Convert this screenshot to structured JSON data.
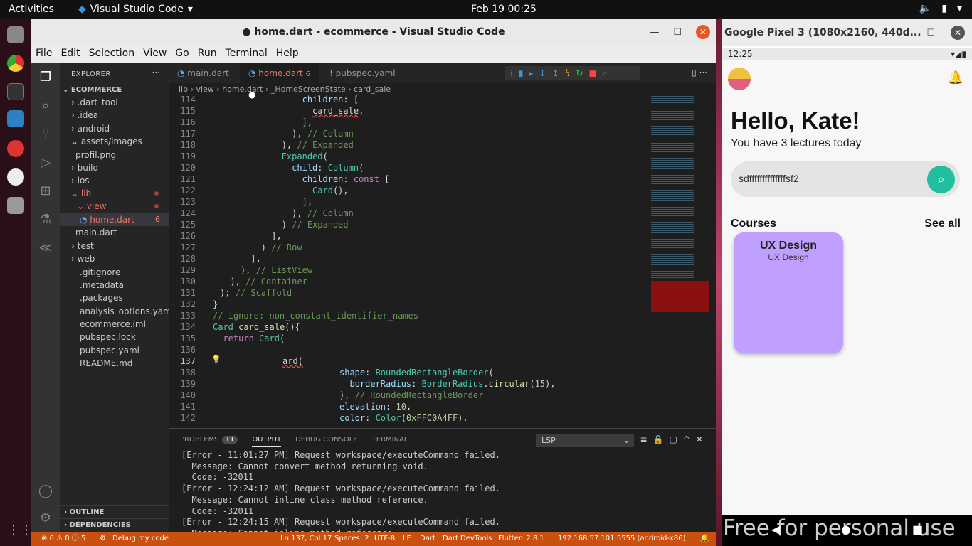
{
  "topbar": {
    "activities": "Activities",
    "app_name": "Visual Studio Code",
    "clock": "Feb 19  00:25"
  },
  "vscode": {
    "window_title": "● home.dart - ecommerce - Visual Studio Code",
    "menu": [
      "File",
      "Edit",
      "Selection",
      "View",
      "Go",
      "Run",
      "Terminal",
      "Help"
    ],
    "explorer_label": "EXPLORER",
    "project": "ECOMMERCE",
    "tree": [
      {
        "label": "› .dart_tool"
      },
      {
        "label": "› .idea"
      },
      {
        "label": "› android"
      },
      {
        "label": "⌄ assets/images"
      },
      {
        "label": "profil.png"
      },
      {
        "label": "› build"
      },
      {
        "label": "› ios"
      },
      {
        "label": "⌄ lib"
      },
      {
        "label": "⌄ view"
      },
      {
        "label": "home.dart",
        "count": "6"
      },
      {
        "label": "main.dart"
      },
      {
        "label": "› test"
      },
      {
        "label": "› web"
      },
      {
        "label": ".gitignore"
      },
      {
        "label": ".metadata"
      },
      {
        "label": ".packages"
      },
      {
        "label": "analysis_options.yaml"
      },
      {
        "label": "ecommerce.iml"
      },
      {
        "label": "pubspec.lock"
      },
      {
        "label": "pubspec.yaml"
      },
      {
        "label": "README.md"
      }
    ],
    "outline": "OUTLINE",
    "dependencies": "DEPENDENCIES",
    "tabs": [
      {
        "label": "main.dart"
      },
      {
        "label": "home.dart",
        "count": "6"
      },
      {
        "label": "pubspec.yaml"
      }
    ],
    "breadcrumb": "lib › view › home.dart › _HomeScreenState › card_sale",
    "line_numbers": [
      "114",
      "115",
      "116",
      "117",
      "118",
      "119",
      "120",
      "121",
      "122",
      "123",
      "124",
      "125",
      "126",
      "127",
      "128",
      "129",
      "130",
      "131",
      "132",
      "133",
      "134",
      "135",
      "136",
      "137",
      "138",
      "139",
      "140",
      "141",
      "142"
    ],
    "panel": {
      "tabs": [
        "PROBLEMS",
        "OUTPUT",
        "DEBUG CONSOLE",
        "TERMINAL"
      ],
      "problems_count": "11",
      "channel": "LSP",
      "lines": [
        "[Error - 11:01:27 PM] Request workspace/executeCommand failed.",
        "  Message: Cannot convert method returning void.",
        "  Code: -32011",
        "[Error - 12:24:12 AM] Request workspace/executeCommand failed.",
        "  Message: Cannot inline class method reference.",
        "  Code: -32011",
        "[Error - 12:24:15 AM] Request workspace/executeCommand failed.",
        "  Message: Cannot inline method reference."
      ]
    },
    "status": {
      "problems": "⊗ 6 ⚠ 0 ⓘ 5",
      "debug": "Debug my code",
      "position": "Ln 137, Col 17",
      "spaces": "Spaces: 2",
      "encoding": "UTF-8",
      "eol": "LF",
      "language": "Dart",
      "devtools": "Dart DevTools",
      "flutter": "Flutter: 2.8.1",
      "device": "192.168.57.101:5555 (android-x86)"
    }
  },
  "emulator": {
    "title": "Google Pixel 3 (1080x2160, 440d...",
    "phone_time": "12:25",
    "greeting": "Hello, Kate!",
    "subtitle": "You have 3 lectures today",
    "search_value": "sdffffffffffffffsf2",
    "courses_label": "Courses",
    "see_all": "See all",
    "card_title": "UX Design",
    "card_subtitle": "UX Design",
    "card_color": "#c0a0ff",
    "search_button_color": "#1fbf9f",
    "watermark": "Free for personal use"
  }
}
